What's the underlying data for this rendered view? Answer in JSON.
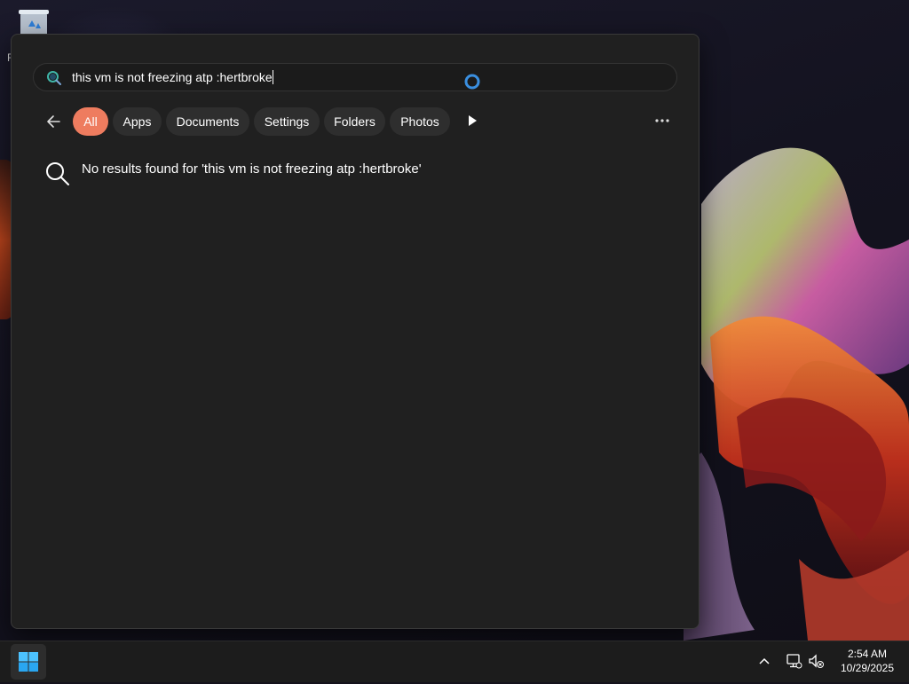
{
  "search": {
    "query": "this vm is not freezing atp :hertbroke"
  },
  "filters": [
    {
      "label": "All",
      "active": true
    },
    {
      "label": "Apps",
      "active": false
    },
    {
      "label": "Documents",
      "active": false
    },
    {
      "label": "Settings",
      "active": false
    },
    {
      "label": "Folders",
      "active": false
    },
    {
      "label": "Photos",
      "active": false
    }
  ],
  "results": {
    "empty_message": "No results found for 'this vm is not freezing atp :hertbroke'"
  },
  "taskbar": {
    "time": "2:54 AM",
    "date": "10/29/2025"
  },
  "desktop": {
    "icon_name": "recycle-bin-icon",
    "partial_label": "R"
  },
  "colors": {
    "active_chip": "#ee7c5f",
    "busy_ring": "#3a8fe0"
  }
}
